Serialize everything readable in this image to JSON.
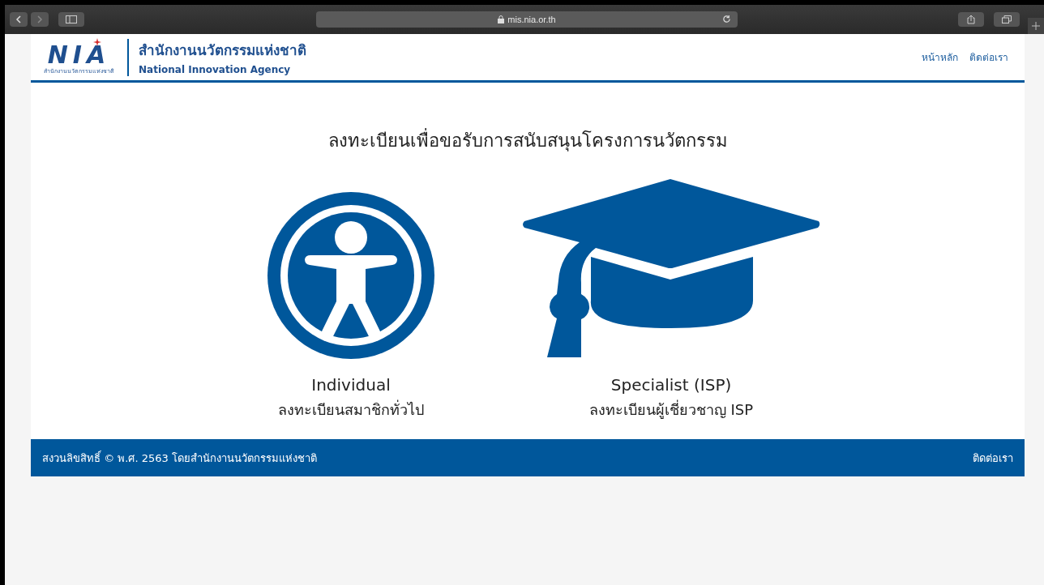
{
  "browser": {
    "url": "mis.nia.or.th"
  },
  "header": {
    "logo_text": "NIA",
    "logo_caption": "สำนักงานนวัตกรรมแห่งชาติ",
    "org_name_th": "สำนักงานนวัตกรรมแห่งชาติ",
    "org_name_en": "National Innovation Agency",
    "nav": [
      {
        "label": "หน้าหลัก"
      },
      {
        "label": "ติดต่อเรา"
      }
    ]
  },
  "heading": "ลงทะเบียนเพื่อขอรับการสนับสนุนโครงการนวัตกรรม",
  "options": [
    {
      "kind": "individual",
      "title": "Individual",
      "subtitle": "ลงทะเบียนสมาชิกทั่วไป"
    },
    {
      "kind": "specialist",
      "title": "Specialist (ISP)",
      "subtitle": "ลงทะเบียนผู้เชี่ยวชาญ ISP"
    }
  ],
  "footer": {
    "copyright": "สงวนลิขสิทธิ์ © พ.ศ. 2563 โดยสำนักงานนวัตกรรมแห่งชาติ",
    "link": "ติดต่อเรา"
  }
}
